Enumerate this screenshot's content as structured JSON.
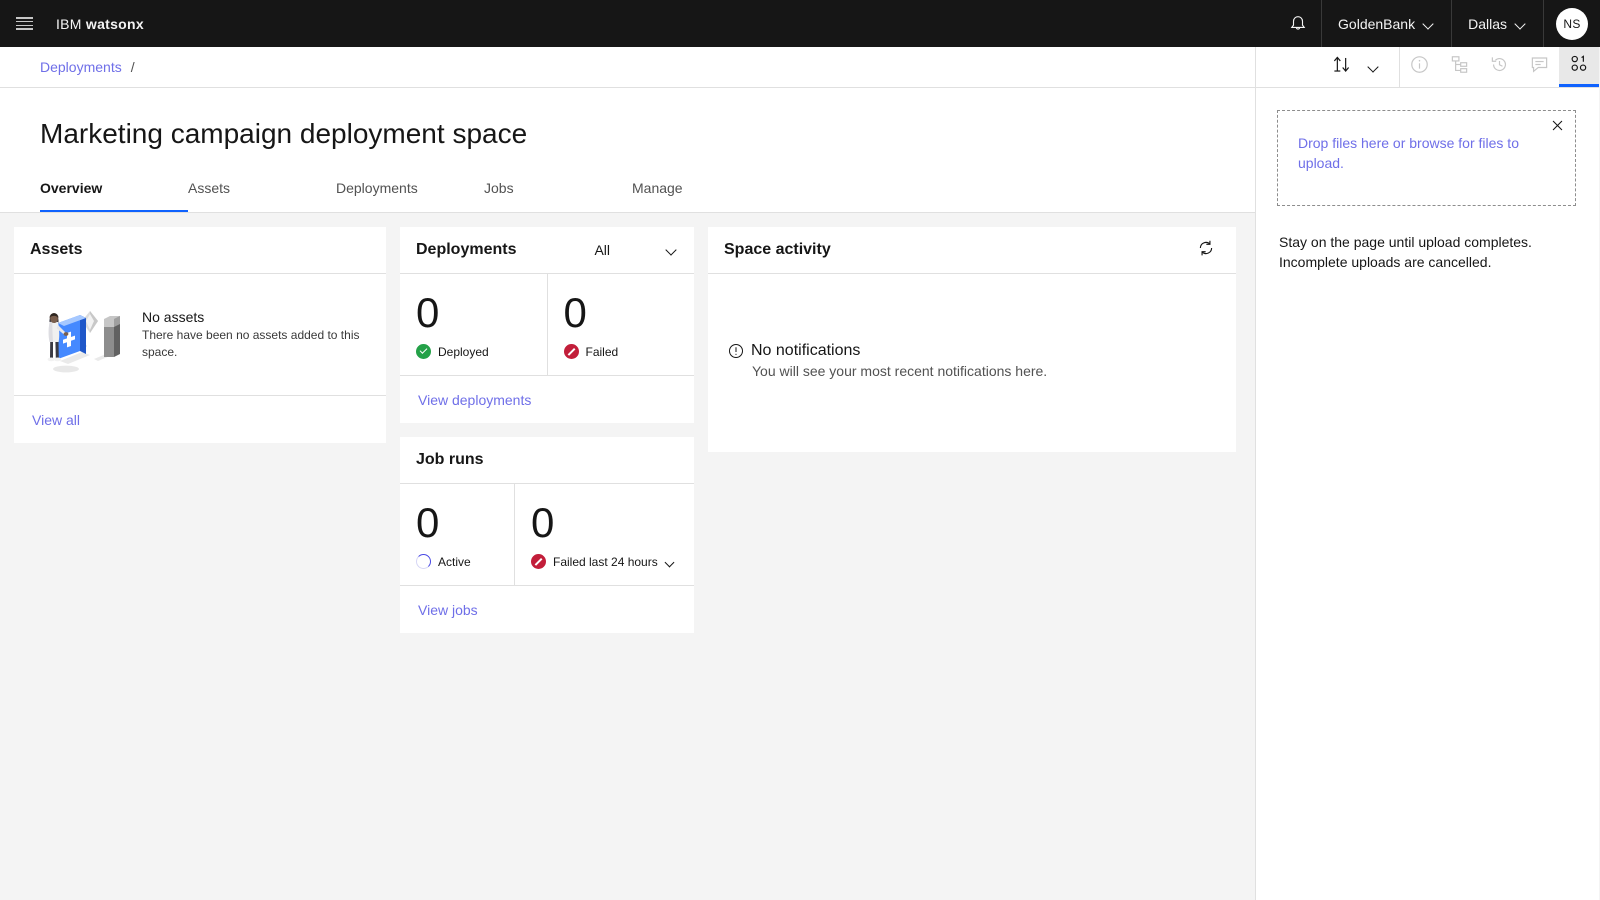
{
  "header": {
    "menu_icon": "hamburger-menu-icon",
    "brand_ibm": "IBM",
    "brand_product": "watsonx",
    "notifications_icon": "bell-icon",
    "account": "GoldenBank",
    "region": "Dallas",
    "avatar_initials": "NS"
  },
  "breadcrumb": {
    "item": "Deployments",
    "separator": "/"
  },
  "page": {
    "title": "Marketing campaign deployment space"
  },
  "tabs": [
    {
      "label": "Overview",
      "active": true
    },
    {
      "label": "Assets",
      "active": false
    },
    {
      "label": "Deployments",
      "active": false
    },
    {
      "label": "Jobs",
      "active": false
    },
    {
      "label": "Manage",
      "active": false
    }
  ],
  "assets_card": {
    "title": "Assets",
    "illustration": "isometric-person-adding-asset-illustration",
    "empty_title": "No assets",
    "empty_desc": "There have been no assets added to this space.",
    "view_all": "View all"
  },
  "deployments_card": {
    "title": "Deployments",
    "filter_value": "All",
    "filter_chevron": "chevron-down-icon",
    "metrics": [
      {
        "value": "0",
        "label": "Deployed",
        "status": "success",
        "status_icon": "checkmark-filled-icon",
        "color": "#24a148"
      },
      {
        "value": "0",
        "label": "Failed",
        "status": "error",
        "status_icon": "error-filled-icon",
        "color": "#c21e3a"
      }
    ],
    "view_link": "View deployments"
  },
  "job_runs_card": {
    "title": "Job runs",
    "metrics": [
      {
        "value": "0",
        "label": "Active",
        "status": "in-progress",
        "status_icon": "progress-spinner-icon",
        "color": "#4949e4",
        "has_chevron": false
      },
      {
        "value": "0",
        "label": "Failed last 24 hours",
        "status": "error",
        "status_icon": "error-filled-icon",
        "color": "#c21e3a",
        "has_chevron": true
      }
    ],
    "view_link": "View jobs"
  },
  "space_activity_card": {
    "title": "Space activity",
    "refresh_icon": "refresh-icon",
    "empty_title": "No notifications",
    "empty_desc": "You will see your most recent notifications here.",
    "empty_icon": "warning-circle-icon"
  },
  "right_panel": {
    "tools": [
      {
        "name": "upload-download-icon",
        "active": false,
        "muted": false
      },
      {
        "name": "chevron-down-icon",
        "active": false,
        "muted": false
      },
      {
        "name": "information-icon",
        "active": false,
        "muted": true
      },
      {
        "name": "data-structure-icon",
        "active": false,
        "muted": true
      },
      {
        "name": "history-icon",
        "active": false,
        "muted": true
      },
      {
        "name": "comment-icon",
        "active": false,
        "muted": true
      },
      {
        "name": "code-binary-icon",
        "active": true,
        "muted": false
      }
    ],
    "dropzone_text": "Drop files here or browse for files to upload.",
    "close_icon": "close-icon",
    "note_line1": "Stay on the page until upload completes.",
    "note_line2": "Incomplete uploads are cancelled."
  },
  "colors": {
    "header_bg": "#161616",
    "page_bg": "#f4f4f4",
    "card_bg": "#ffffff",
    "link": "#6f6fe8",
    "accent": "#0f62fe",
    "success": "#24a148",
    "error": "#c21e3a",
    "border": "#e0e0e0"
  }
}
